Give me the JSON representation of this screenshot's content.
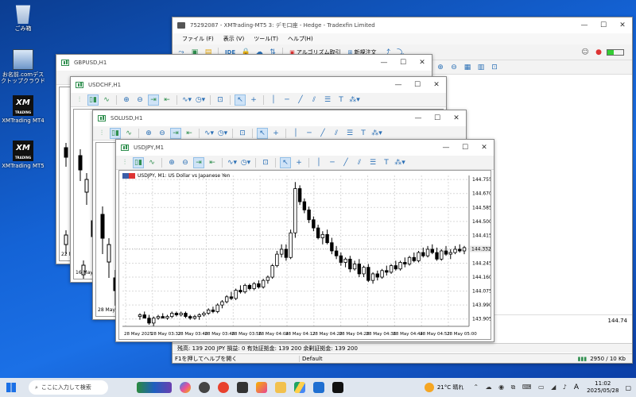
{
  "desktop": {
    "icons": [
      {
        "label": "ごみ箱"
      },
      {
        "label": "お名前.comデスクトップクラウド"
      },
      {
        "label": "XMTrading MT4"
      },
      {
        "label": "XMTrading MT5"
      }
    ]
  },
  "main_window": {
    "title": "75292087 - XMTrading-MT5 3: デモ口座 - Hedge - Tradexfin Limited",
    "menu": [
      "ファイル (F)",
      "表示 (V)",
      "ツール(T)",
      "ヘルプ(H)"
    ],
    "toolbar": {
      "ide": "IDE",
      "algo": "アルゴリズム取引",
      "new_order": "新規注文"
    },
    "status": {
      "balance_line": "残高: 139 200 JPY  損益: 0  有効証拠金: 139 200  余剰証拠金: 139 200",
      "help": "F1を押してヘルプを開く",
      "profile": "Default",
      "traffic": "2950 / 10 Kb"
    },
    "mini_value": "144.74"
  },
  "charts": [
    {
      "title": "GBPUSD,H1",
      "date_label": "22 May"
    },
    {
      "title": "USDCHF,H1",
      "date_label": "16 May"
    },
    {
      "title": "SOLUSD,H1",
      "date_label": "28 May 202"
    },
    {
      "title": "USDJPY,M1"
    }
  ],
  "chart_data": {
    "type": "candlestick",
    "title": "USDJPY, M1:  US Dollar vs Japanese Yen",
    "symbol": "USDJPY",
    "timeframe": "M1",
    "y_ticks": [
      "144.755",
      "144.670",
      "144.585",
      "144.500",
      "144.415",
      "144.330",
      "144.245",
      "144.160",
      "144.075",
      "143.990",
      "143.905"
    ],
    "x_ticks": [
      "28 May 2025",
      "28 May 03:32",
      "28 May 03:40",
      "28 May 03:48",
      "28 May 03:56",
      "28 May 04:04",
      "28 May 04:12",
      "28 May 04:20",
      "28 May 04:28",
      "28 May 04:36",
      "28 May 04:44",
      "28 May 04:52",
      "28 May 05:00"
    ],
    "ylim": [
      143.86,
      144.78
    ],
    "grid": true,
    "current_price": "144.332",
    "candles": [
      [
        143.92,
        143.94,
        143.9,
        143.93
      ],
      [
        143.93,
        143.95,
        143.91,
        143.91
      ],
      [
        143.91,
        143.93,
        143.87,
        143.88
      ],
      [
        143.88,
        143.92,
        143.86,
        143.91
      ],
      [
        143.91,
        143.93,
        143.9,
        143.92
      ],
      [
        143.92,
        143.94,
        143.91,
        143.91
      ],
      [
        143.91,
        143.93,
        143.9,
        143.92
      ],
      [
        143.92,
        143.95,
        143.91,
        143.94
      ],
      [
        143.94,
        143.95,
        143.92,
        143.93
      ],
      [
        143.93,
        143.95,
        143.92,
        143.94
      ],
      [
        143.94,
        143.95,
        143.91,
        143.92
      ],
      [
        143.92,
        143.93,
        143.9,
        143.91
      ],
      [
        143.91,
        143.93,
        143.9,
        143.92
      ],
      [
        143.92,
        143.94,
        143.9,
        143.93
      ],
      [
        143.93,
        143.95,
        143.92,
        143.94
      ],
      [
        143.94,
        143.97,
        143.93,
        143.96
      ],
      [
        143.96,
        143.98,
        143.94,
        143.95
      ],
      [
        143.95,
        144.0,
        143.94,
        143.99
      ],
      [
        143.99,
        144.02,
        143.97,
        144.01
      ],
      [
        144.01,
        144.05,
        144.0,
        144.04
      ],
      [
        144.04,
        144.07,
        144.02,
        144.03
      ],
      [
        144.03,
        144.09,
        144.02,
        144.08
      ],
      [
        144.08,
        144.11,
        144.06,
        144.07
      ],
      [
        144.07,
        144.12,
        144.06,
        144.11
      ],
      [
        144.11,
        144.12,
        144.08,
        144.09
      ],
      [
        144.09,
        144.13,
        144.08,
        144.12
      ],
      [
        144.12,
        144.14,
        144.09,
        144.1
      ],
      [
        144.1,
        144.15,
        144.09,
        144.14
      ],
      [
        144.14,
        144.17,
        144.12,
        144.16
      ],
      [
        144.16,
        144.24,
        144.15,
        144.23
      ],
      [
        144.23,
        144.32,
        144.22,
        144.3
      ],
      [
        144.3,
        144.36,
        144.28,
        144.33
      ],
      [
        144.33,
        144.36,
        144.26,
        144.28
      ],
      [
        144.28,
        144.45,
        144.27,
        144.43
      ],
      [
        144.43,
        144.74,
        144.4,
        144.7
      ],
      [
        144.7,
        144.72,
        144.6,
        144.62
      ],
      [
        144.62,
        144.64,
        144.55,
        144.57
      ],
      [
        144.57,
        144.59,
        144.49,
        144.51
      ],
      [
        144.51,
        144.53,
        144.44,
        144.46
      ],
      [
        144.46,
        144.48,
        144.39,
        144.4
      ],
      [
        144.4,
        144.44,
        144.36,
        144.42
      ],
      [
        144.42,
        144.45,
        144.36,
        144.37
      ],
      [
        144.37,
        144.4,
        144.3,
        144.32
      ],
      [
        144.32,
        144.35,
        144.27,
        144.29
      ],
      [
        144.29,
        144.31,
        144.23,
        144.25
      ],
      [
        144.25,
        144.28,
        144.22,
        144.27
      ],
      [
        144.27,
        144.29,
        144.19,
        144.21
      ],
      [
        144.21,
        144.26,
        144.2,
        144.24
      ],
      [
        144.24,
        144.27,
        144.16,
        144.18
      ],
      [
        144.18,
        144.23,
        144.16,
        144.22
      ],
      [
        144.22,
        144.24,
        144.13,
        144.14
      ],
      [
        144.14,
        144.19,
        144.12,
        144.18
      ],
      [
        144.18,
        144.2,
        144.14,
        144.16
      ],
      [
        144.16,
        144.21,
        144.15,
        144.2
      ],
      [
        144.2,
        144.23,
        144.17,
        144.19
      ],
      [
        144.19,
        144.24,
        144.18,
        144.23
      ],
      [
        144.23,
        144.26,
        144.2,
        144.21
      ],
      [
        144.21,
        144.26,
        144.2,
        144.25
      ],
      [
        144.25,
        144.28,
        144.22,
        144.24
      ],
      [
        144.24,
        144.29,
        144.23,
        144.28
      ],
      [
        144.28,
        144.31,
        144.25,
        144.26
      ],
      [
        144.26,
        144.32,
        144.25,
        144.31
      ],
      [
        144.31,
        144.34,
        144.28,
        144.29
      ],
      [
        144.29,
        144.35,
        144.28,
        144.33
      ],
      [
        144.33,
        144.36,
        144.3,
        144.31
      ],
      [
        144.31,
        144.34,
        144.26,
        144.27
      ],
      [
        144.27,
        144.33,
        144.26,
        144.32
      ],
      [
        144.32,
        144.35,
        144.29,
        144.3
      ],
      [
        144.3,
        144.33,
        144.27,
        144.31
      ],
      [
        144.31,
        144.35,
        144.3,
        144.33
      ],
      [
        144.33,
        144.36,
        144.31,
        144.32
      ],
      [
        144.32,
        144.35,
        144.3,
        144.34
      ]
    ]
  },
  "taskbar": {
    "search_placeholder": "ここに入力して検索",
    "weather": "21°C  晴れ",
    "ime": "A",
    "time": "11:02",
    "date": "2025/05/28"
  }
}
